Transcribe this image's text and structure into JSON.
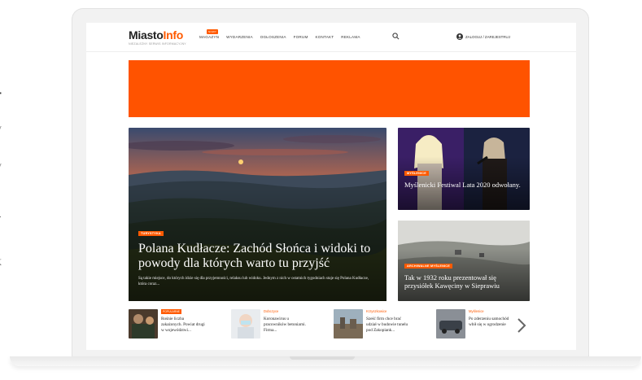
{
  "side_text": [
    "+",
    "y",
    "y",
    "y",
    "k"
  ],
  "site": {
    "logo_part1": "Miasto",
    "logo_part2": "Info",
    "logo_tagline": "NIEZALEŻNY SERWIS INFORMACYJNY",
    "nav": [
      {
        "label": "MAGAZYN",
        "badge": "NOWY"
      },
      {
        "label": "WYDARZENIA"
      },
      {
        "label": "OGŁOSZENIA"
      },
      {
        "label": "FORUM"
      },
      {
        "label": "KONTAKT"
      },
      {
        "label": "REKLAMA"
      }
    ],
    "login_label": "ZALOGUJ / ZAREJESTRUJ"
  },
  "colors": {
    "accent": "#ff5a00",
    "banner": "#ff5300"
  },
  "featured": {
    "main": {
      "tag": "TURYSTYKA",
      "title": "Polana Kudłacze: Zachód Słońca i widoki to powody dla których warto tu przyjść",
      "lead": "Są takie miejsce, do których idzie się dla przyjemności, relaksu lub widoku. Jednym z nich w ostatnich tygodniach staje się Polana Kudłacze, która coraz..."
    },
    "top_right": {
      "tag": "MYŚLENICE",
      "title": "Myślenicki Festiwal Lata 2020 odwołany."
    },
    "bottom_right": {
      "tag": "ARCHIWALNE MYŚLENICE",
      "title": "Tak w 1932 roku prezentował się przysiółek Kawęciny w Sieprawiu"
    }
  },
  "strip": [
    {
      "category": "POPULARNE",
      "category_style": "tag",
      "title": "Rośnie liczba zakażonych. Powiat drugi w województwi..."
    },
    {
      "category": "Dobczyce",
      "category_style": "text",
      "title": "Koronawirus u pracowników betoniarni. Firma..."
    },
    {
      "category": "Krzyszkowice",
      "category_style": "text",
      "title": "Sześć firm chce brać udział w budowie tunelu pod Zakopiank..."
    },
    {
      "category": "Myślenice",
      "category_style": "text",
      "title": "Po zderzeniu samochód wbił się w ogrodzenie"
    }
  ]
}
